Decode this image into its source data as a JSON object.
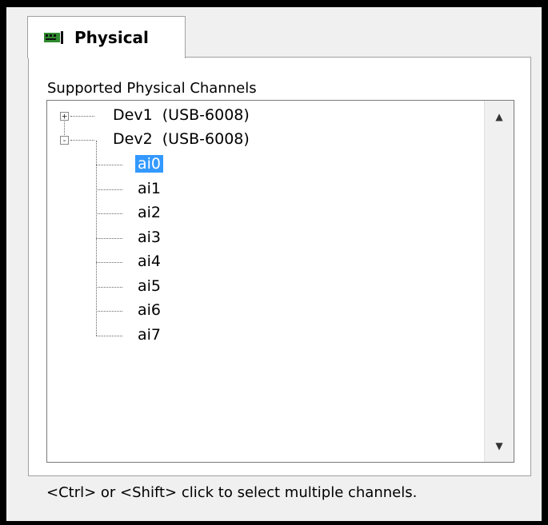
{
  "tab": {
    "label": "Physical",
    "icon": "device-icon"
  },
  "panel": {
    "title": "Supported Physical Channels"
  },
  "tree": {
    "devices": [
      {
        "name": "Dev1",
        "model": "(USB-6008)",
        "expanded": false,
        "expander": "+"
      },
      {
        "name": "Dev2",
        "model": "(USB-6008)",
        "expanded": true,
        "expander": "-"
      }
    ],
    "channels": [
      "ai0",
      "ai1",
      "ai2",
      "ai3",
      "ai4",
      "ai5",
      "ai6",
      "ai7"
    ],
    "selected_channel": "ai0"
  },
  "footer": {
    "hint": "<Ctrl> or <Shift> click to select multiple channels."
  },
  "colors": {
    "selection": "#3399ff",
    "icon_green": "#2e8b2e"
  }
}
